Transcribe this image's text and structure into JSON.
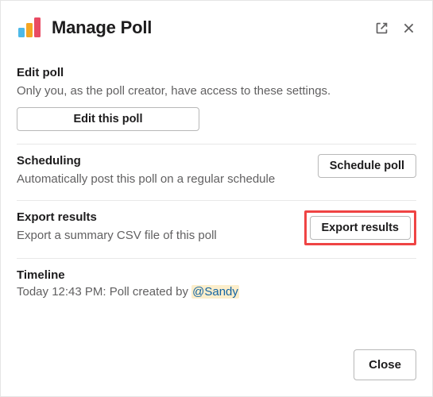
{
  "header": {
    "title": "Manage Poll"
  },
  "sections": {
    "edit": {
      "title": "Edit poll",
      "desc": "Only you, as the poll creator, have access to these settings.",
      "button": "Edit this poll"
    },
    "scheduling": {
      "title": "Scheduling",
      "desc": "Automatically post this poll on a regular schedule",
      "button": "Schedule poll"
    },
    "export": {
      "title": "Export results",
      "desc": "Export a summary CSV file of this poll",
      "button": "Export results"
    },
    "timeline": {
      "title": "Timeline",
      "prefix": "Today 12:43 PM: Poll created by ",
      "mention": "@Sandy"
    }
  },
  "footer": {
    "close": "Close"
  }
}
